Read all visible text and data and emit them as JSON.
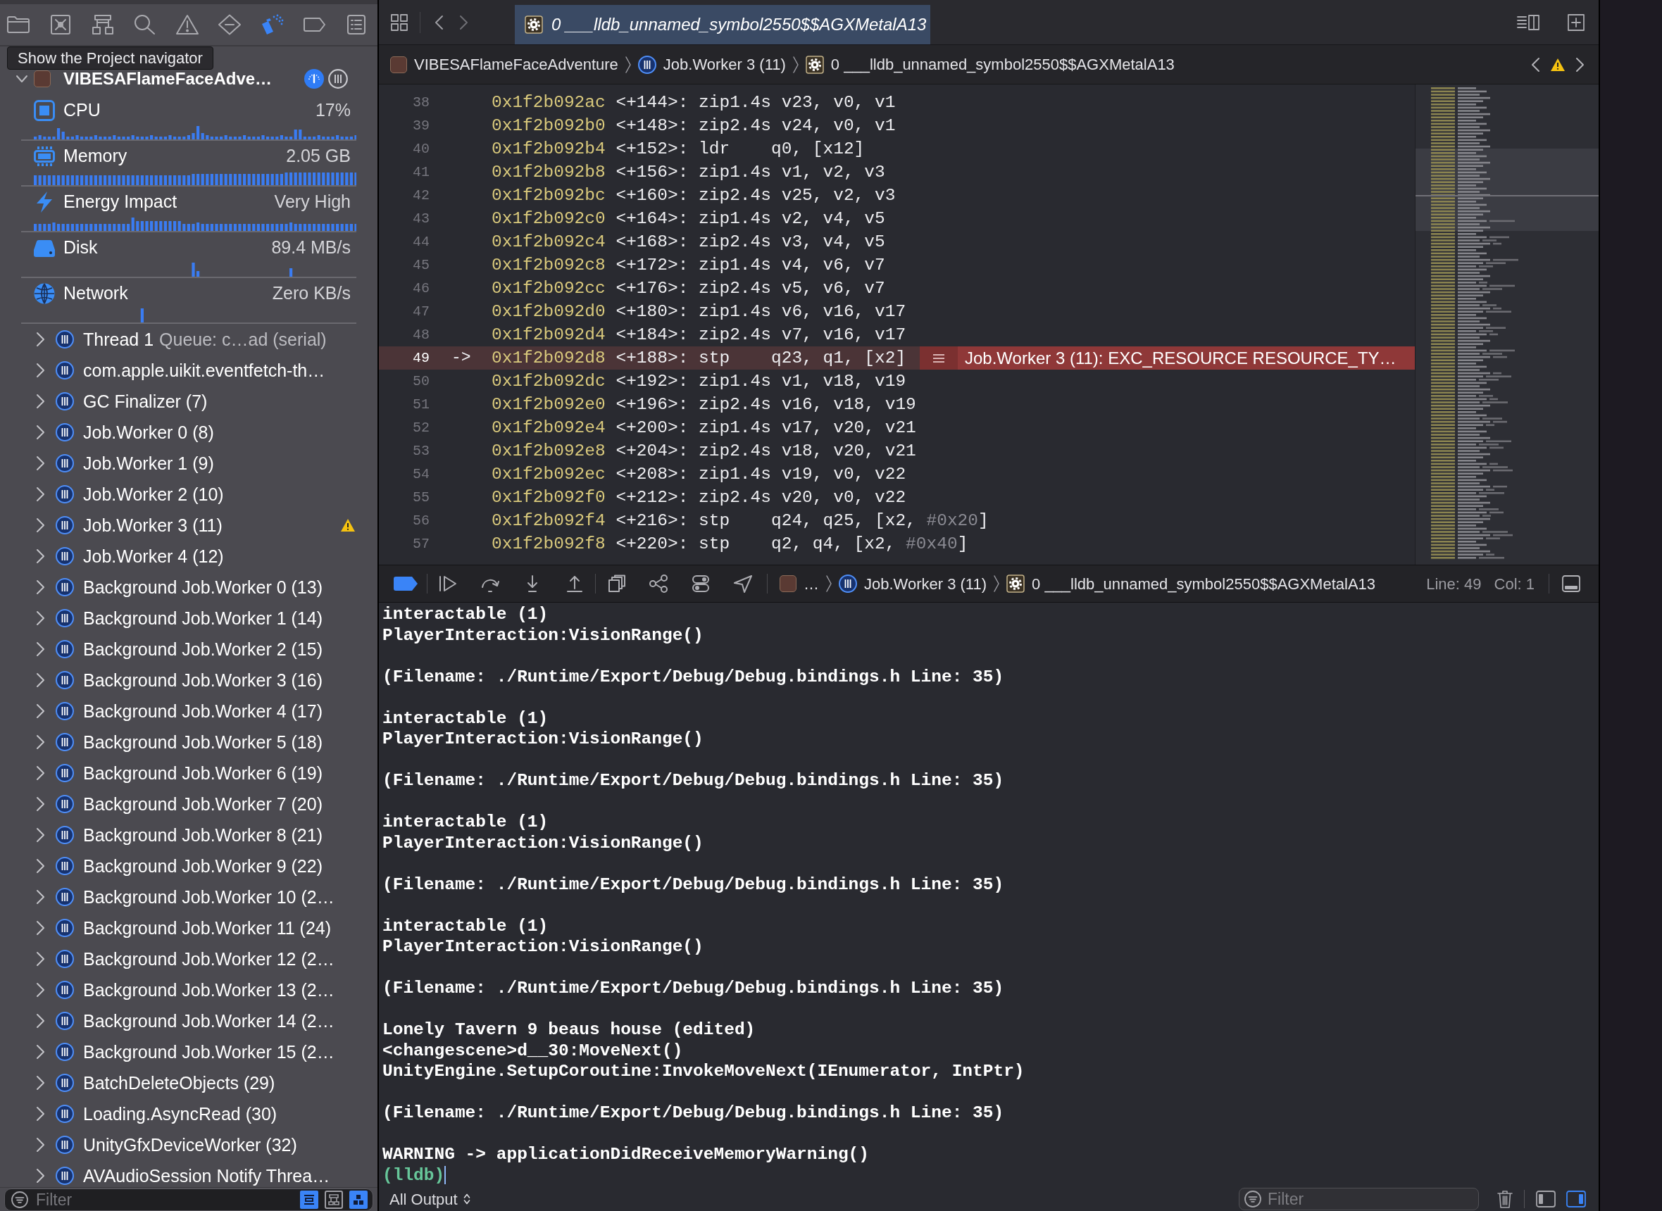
{
  "navigator": {
    "toolbar": [
      {
        "kind": "project",
        "selected": false
      },
      {
        "kind": "source_control",
        "selected": false
      },
      {
        "kind": "symbols",
        "selected": false
      },
      {
        "kind": "find",
        "selected": false
      },
      {
        "kind": "issues",
        "selected": false
      },
      {
        "kind": "tests",
        "selected": false
      },
      {
        "kind": "debug",
        "selected": true
      },
      {
        "kind": "breakpoints",
        "selected": false
      },
      {
        "kind": "reports",
        "selected": false
      }
    ],
    "tooltip": "Show the Project navigator",
    "process": {
      "name": "VIBESAFlameFaceAdve…",
      "expanded": true
    },
    "gauges": [
      {
        "kind": "cpu",
        "label": "CPU",
        "value": "17%"
      },
      {
        "kind": "memory",
        "label": "Memory",
        "value": "2.05 GB"
      },
      {
        "kind": "energy",
        "label": "Energy Impact",
        "value": "Very High"
      },
      {
        "kind": "disk",
        "label": "Disk",
        "value": "89.4 MB/s"
      },
      {
        "kind": "network",
        "label": "Network",
        "value": "Zero KB/s"
      }
    ],
    "threads": [
      {
        "name": "Thread 1",
        "detail": "Queue: c…ad (serial)",
        "expanded": false,
        "warning": false
      },
      {
        "name": "com.apple.uikit.eventfetch-th…",
        "expanded": false,
        "warning": false
      },
      {
        "name": "GC Finalizer (7)",
        "expanded": false,
        "warning": false
      },
      {
        "name": "Job.Worker 0 (8)",
        "expanded": false,
        "warning": false
      },
      {
        "name": "Job.Worker 1 (9)",
        "expanded": false,
        "warning": false
      },
      {
        "name": "Job.Worker 2 (10)",
        "expanded": false,
        "warning": false
      },
      {
        "name": "Job.Worker 3 (11)",
        "expanded": false,
        "warning": true
      },
      {
        "name": "Job.Worker 4 (12)",
        "expanded": false,
        "warning": false
      },
      {
        "name": "Background Job.Worker 0 (13)",
        "expanded": false,
        "warning": false
      },
      {
        "name": "Background Job.Worker 1 (14)",
        "expanded": false,
        "warning": false
      },
      {
        "name": "Background Job.Worker 2 (15)",
        "expanded": false,
        "warning": false
      },
      {
        "name": "Background Job.Worker 3 (16)",
        "expanded": false,
        "warning": false
      },
      {
        "name": "Background Job.Worker 4 (17)",
        "expanded": false,
        "warning": false
      },
      {
        "name": "Background Job.Worker 5 (18)",
        "expanded": false,
        "warning": false
      },
      {
        "name": "Background Job.Worker 6 (19)",
        "expanded": false,
        "warning": false
      },
      {
        "name": "Background Job.Worker 7 (20)",
        "expanded": false,
        "warning": false
      },
      {
        "name": "Background Job.Worker 8 (21)",
        "expanded": false,
        "warning": false
      },
      {
        "name": "Background Job.Worker 9 (22)",
        "expanded": false,
        "warning": false
      },
      {
        "name": "Background Job.Worker 10 (2…",
        "expanded": false,
        "warning": false
      },
      {
        "name": "Background Job.Worker 11 (24)",
        "expanded": false,
        "warning": false
      },
      {
        "name": "Background Job.Worker 12 (2…",
        "expanded": false,
        "warning": false
      },
      {
        "name": "Background Job.Worker 13 (2…",
        "expanded": false,
        "warning": false
      },
      {
        "name": "Background Job.Worker 14 (2…",
        "expanded": false,
        "warning": false
      },
      {
        "name": "Background Job.Worker 15 (2…",
        "expanded": false,
        "warning": false
      },
      {
        "name": "BatchDeleteObjects (29)",
        "expanded": false,
        "warning": false
      },
      {
        "name": "Loading.AsyncRead (30)",
        "expanded": false,
        "warning": false
      },
      {
        "name": "UnityGfxDeviceWorker (32)",
        "expanded": false,
        "warning": false
      },
      {
        "name": "AVAudioSession Notify Threa…",
        "expanded": false,
        "warning": false
      }
    ],
    "filter": {
      "placeholder": "Filter",
      "toggles": [
        {
          "kind": "bar",
          "on": true
        },
        {
          "kind": "tree",
          "on": false
        },
        {
          "kind": "blocks",
          "on": true
        }
      ]
    }
  },
  "editor": {
    "tab": {
      "title": "0 ___lldb_unnamed_symbol2550$$AGXMetalA13",
      "selected": true
    },
    "breadcrumb": [
      {
        "kind": "app",
        "label": "VIBESAFlameFaceAdventure"
      },
      {
        "kind": "thread",
        "label": "Job.Worker 3 (11)"
      },
      {
        "kind": "frame",
        "label": "0 ___lldb_unnamed_symbol2550$$AGXMetalA13"
      }
    ],
    "lines": [
      {
        "number": "38",
        "current": false,
        "code": [
          {
            "kind": "address",
            "text": "0x1f2b092ac"
          },
          {
            "kind": "plain",
            "text": " <+144>: zip1.4s v23, v0, v1"
          }
        ]
      },
      {
        "number": "39",
        "current": false,
        "code": [
          {
            "kind": "address",
            "text": "0x1f2b092b0"
          },
          {
            "kind": "plain",
            "text": " <+148>: zip2.4s v24, v0, v1"
          }
        ]
      },
      {
        "number": "40",
        "current": false,
        "code": [
          {
            "kind": "address",
            "text": "0x1f2b092b4"
          },
          {
            "kind": "plain",
            "text": " <+152>: ldr    q0, [x12]"
          }
        ]
      },
      {
        "number": "41",
        "current": false,
        "code": [
          {
            "kind": "address",
            "text": "0x1f2b092b8"
          },
          {
            "kind": "plain",
            "text": " <+156>: zip1.4s v1, v2, v3"
          }
        ]
      },
      {
        "number": "42",
        "current": false,
        "code": [
          {
            "kind": "address",
            "text": "0x1f2b092bc"
          },
          {
            "kind": "plain",
            "text": " <+160>: zip2.4s v25, v2, v3"
          }
        ]
      },
      {
        "number": "43",
        "current": false,
        "code": [
          {
            "kind": "address",
            "text": "0x1f2b092c0"
          },
          {
            "kind": "plain",
            "text": " <+164>: zip1.4s v2, v4, v5"
          }
        ]
      },
      {
        "number": "44",
        "current": false,
        "code": [
          {
            "kind": "address",
            "text": "0x1f2b092c4"
          },
          {
            "kind": "plain",
            "text": " <+168>: zip2.4s v3, v4, v5"
          }
        ]
      },
      {
        "number": "45",
        "current": false,
        "code": [
          {
            "kind": "address",
            "text": "0x1f2b092c8"
          },
          {
            "kind": "plain",
            "text": " <+172>: zip1.4s v4, v6, v7"
          }
        ]
      },
      {
        "number": "46",
        "current": false,
        "code": [
          {
            "kind": "address",
            "text": "0x1f2b092cc"
          },
          {
            "kind": "plain",
            "text": " <+176>: zip2.4s v5, v6, v7"
          }
        ]
      },
      {
        "number": "47",
        "current": false,
        "code": [
          {
            "kind": "address",
            "text": "0x1f2b092d0"
          },
          {
            "kind": "plain",
            "text": " <+180>: zip1.4s v6, v16, v17"
          }
        ]
      },
      {
        "number": "48",
        "current": false,
        "code": [
          {
            "kind": "address",
            "text": "0x1f2b092d4"
          },
          {
            "kind": "plain",
            "text": " <+184>: zip2.4s v7, v16, v17"
          }
        ]
      },
      {
        "number": "49",
        "current": true,
        "marker": "->",
        "banner": "Job.Worker 3 (11): EXC_RESOURCE RESOURCE_TY…",
        "code": [
          {
            "kind": "address",
            "text": "0x1f2b092d8"
          },
          {
            "kind": "plain",
            "text": " <+188>: stp    q23, q1, [x2]"
          }
        ]
      },
      {
        "number": "50",
        "current": false,
        "code": [
          {
            "kind": "address",
            "text": "0x1f2b092dc"
          },
          {
            "kind": "plain",
            "text": " <+192>: zip1.4s v1, v18, v19"
          }
        ]
      },
      {
        "number": "51",
        "current": false,
        "code": [
          {
            "kind": "address",
            "text": "0x1f2b092e0"
          },
          {
            "kind": "plain",
            "text": " <+196>: zip2.4s v16, v18, v19"
          }
        ]
      },
      {
        "number": "52",
        "current": false,
        "code": [
          {
            "kind": "address",
            "text": "0x1f2b092e4"
          },
          {
            "kind": "plain",
            "text": " <+200>: zip1.4s v17, v20, v21"
          }
        ]
      },
      {
        "number": "53",
        "current": false,
        "code": [
          {
            "kind": "address",
            "text": "0x1f2b092e8"
          },
          {
            "kind": "plain",
            "text": " <+204>: zip2.4s v18, v20, v21"
          }
        ]
      },
      {
        "number": "54",
        "current": false,
        "code": [
          {
            "kind": "address",
            "text": "0x1f2b092ec"
          },
          {
            "kind": "plain",
            "text": " <+208>: zip1.4s v19, v0, v22"
          }
        ]
      },
      {
        "number": "55",
        "current": false,
        "code": [
          {
            "kind": "address",
            "text": "0x1f2b092f0"
          },
          {
            "kind": "plain",
            "text": " <+212>: zip2.4s v20, v0, v22"
          }
        ]
      },
      {
        "number": "56",
        "current": false,
        "code": [
          {
            "kind": "address",
            "text": "0x1f2b092f4"
          },
          {
            "kind": "plain",
            "text": " <+216>: stp    q24, q25, [x2, "
          },
          {
            "kind": "immediate",
            "text": "#0x20"
          },
          {
            "kind": "plain",
            "text": "]"
          }
        ]
      },
      {
        "number": "57",
        "current": false,
        "code": [
          {
            "kind": "address",
            "text": "0x1f2b092f8"
          },
          {
            "kind": "plain",
            "text": " <+220>: stp    q2, q4, [x2, "
          },
          {
            "kind": "immediate",
            "text": "#0x40"
          },
          {
            "kind": "plain",
            "text": "]"
          }
        ]
      }
    ]
  },
  "debug_bar": {
    "breakpoints_on": true,
    "path": [
      {
        "kind": "app",
        "label": "…"
      },
      {
        "kind": "thread",
        "label": "Job.Worker 3 (11)"
      },
      {
        "kind": "frame",
        "label": "0 ___lldb_unnamed_symbol2550$$AGXMetalA13"
      }
    ],
    "line": "Line: 49",
    "column": "Col: 1"
  },
  "console": {
    "groups": [
      [
        "interactable (1)",
        "PlayerInteraction:VisionRange()"
      ],
      [
        "(Filename: ./Runtime/Export/Debug/Debug.bindings.h Line: 35)"
      ],
      [
        "interactable (1)",
        "PlayerInteraction:VisionRange()"
      ],
      [
        "(Filename: ./Runtime/Export/Debug/Debug.bindings.h Line: 35)"
      ],
      [
        "interactable (1)",
        "PlayerInteraction:VisionRange()"
      ],
      [
        "(Filename: ./Runtime/Export/Debug/Debug.bindings.h Line: 35)"
      ],
      [
        "interactable (1)",
        "PlayerInteraction:VisionRange()"
      ],
      [
        "(Filename: ./Runtime/Export/Debug/Debug.bindings.h Line: 35)"
      ],
      [
        "Lonely Tavern 9 beaus house (edited)",
        "<changescene>d__30:MoveNext()",
        "UnityEngine.SetupCoroutine:InvokeMoveNext(IEnumerator, IntPtr)"
      ],
      [
        "(Filename: ./Runtime/Export/Debug/Debug.bindings.h Line: 35)"
      ],
      [
        "WARNING -> applicationDidReceiveMemoryWarning()"
      ]
    ],
    "prompt": "(lldb)",
    "output_menu": "All Output",
    "filter": {
      "placeholder": "Filter"
    },
    "panes": [
      {
        "kind": "left",
        "on": false
      },
      {
        "kind": "right",
        "on": true
      }
    ]
  }
}
